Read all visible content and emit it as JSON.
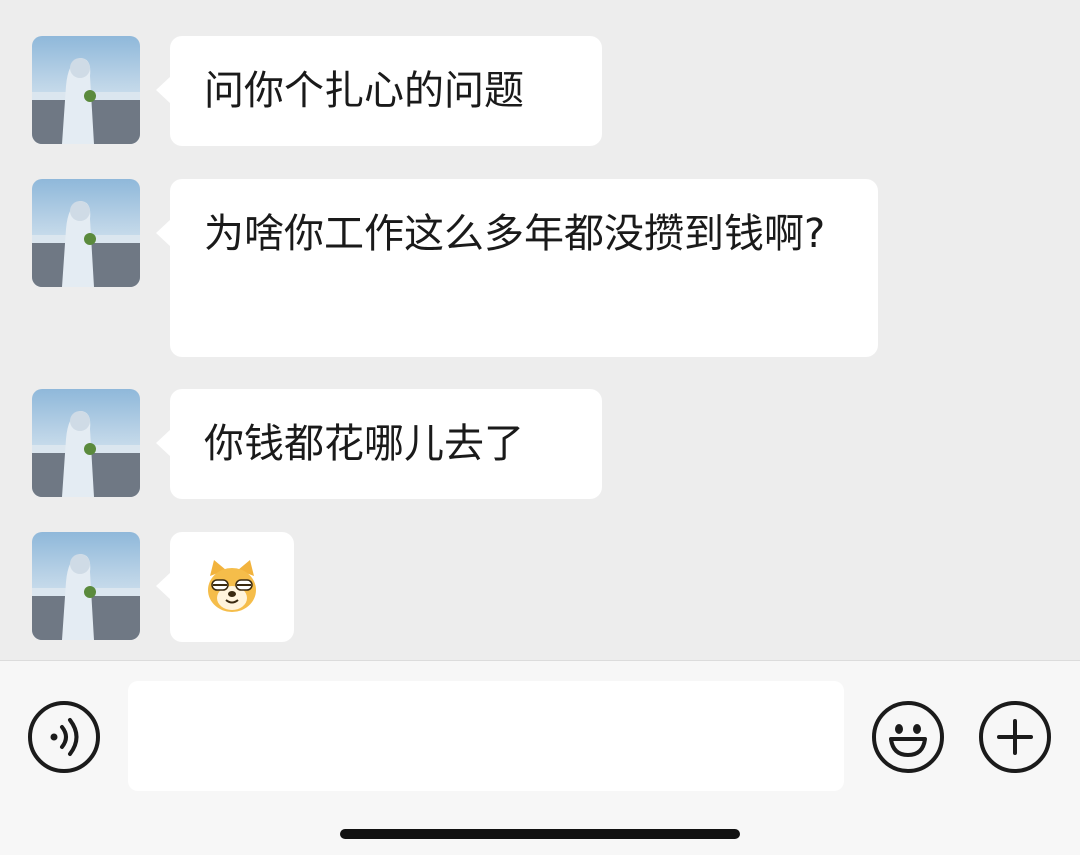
{
  "messages": [
    {
      "sender": "other",
      "type": "text",
      "text": "问你个扎心的问题"
    },
    {
      "sender": "other",
      "type": "text",
      "text": "为啥你工作这么多年都没攒到钱啊?"
    },
    {
      "sender": "other",
      "type": "text",
      "text": "你钱都花哪儿去了"
    },
    {
      "sender": "other",
      "type": "sticker",
      "sticker": "doge-smirk-emoji"
    }
  ],
  "input_bar": {
    "voice_icon": "voice-icon",
    "text_value": "",
    "emoji_icon": "smiley-face-icon",
    "more_icon": "plus-icon"
  },
  "colors": {
    "background": "#ededed",
    "bubble": "#ffffff",
    "input_bar": "#f7f7f7"
  }
}
